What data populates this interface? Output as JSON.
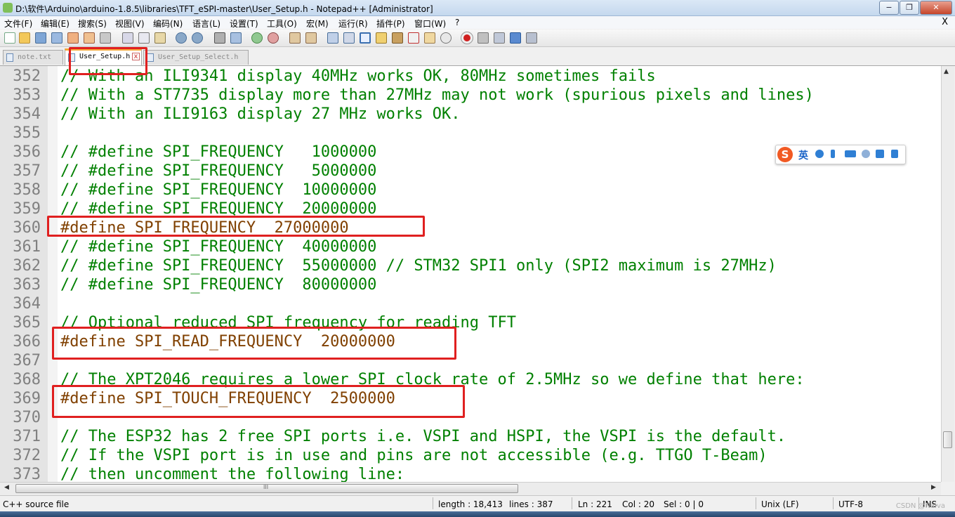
{
  "window": {
    "title": "D:\\软件\\Arduino\\arduino-1.8.5\\libraries\\TFT_eSPI-master\\User_Setup.h - Notepad++ [Administrator]",
    "min_label": "−",
    "max_label": "❐",
    "close_label": "✕"
  },
  "menu": {
    "items": [
      "文件(F)",
      "编辑(E)",
      "搜索(S)",
      "视图(V)",
      "编码(N)",
      "语言(L)",
      "设置(T)",
      "工具(O)",
      "宏(M)",
      "运行(R)",
      "插件(P)",
      "窗口(W)",
      "?"
    ],
    "close_label": "X"
  },
  "toolbar": {
    "icons": [
      "new-file-icon",
      "open-file-icon",
      "save-icon",
      "save-all-icon",
      "close-icon",
      "close-all-icon",
      "print-icon",
      "cut-icon",
      "copy-icon",
      "paste-icon",
      "undo-icon",
      "redo-icon",
      "find-icon",
      "replace-icon",
      "zoom-in-icon",
      "zoom-out-icon",
      "sync-vertical-icon",
      "sync-horizontal-icon",
      "word-wrap-icon",
      "show-all-chars-icon",
      "indent-guide-icon",
      "udl-icon",
      "doc-map-icon",
      "function-list-icon",
      "folder-workspace-icon",
      "monitoring-icon",
      "record-macro-icon",
      "stop-record-icon",
      "play-macro-icon",
      "run-macro-multiple-icon",
      "save-macro-icon"
    ]
  },
  "tabs": [
    {
      "label": "note.txt",
      "active": false
    },
    {
      "label": "User_Setup.h",
      "active": true
    },
    {
      "label": "User_Setup_Select.h",
      "active": false
    }
  ],
  "tab_close_label": "x",
  "editor": {
    "lines": [
      {
        "num": "352",
        "text": "// With an ILI9341 display 40MHz works OK, 80MHz sometimes fails",
        "type": "comment"
      },
      {
        "num": "353",
        "text": "// With a ST7735 display more than 27MHz may not work (spurious pixels and lines)",
        "type": "comment"
      },
      {
        "num": "354",
        "text": "// With an ILI9163 display 27 MHz works OK.",
        "type": "comment"
      },
      {
        "num": "355",
        "text": "",
        "type": "comment"
      },
      {
        "num": "356",
        "text": "// #define SPI_FREQUENCY   1000000",
        "type": "comment"
      },
      {
        "num": "357",
        "text": "// #define SPI_FREQUENCY   5000000",
        "type": "comment"
      },
      {
        "num": "358",
        "text": "// #define SPI_FREQUENCY  10000000",
        "type": "comment"
      },
      {
        "num": "359",
        "text": "// #define SPI_FREQUENCY  20000000",
        "type": "comment"
      },
      {
        "num": "360",
        "text": "#define SPI_FREQUENCY  27000000",
        "type": "directive"
      },
      {
        "num": "361",
        "text": "// #define SPI_FREQUENCY  40000000",
        "type": "comment"
      },
      {
        "num": "362",
        "text": "// #define SPI_FREQUENCY  55000000 // STM32 SPI1 only (SPI2 maximum is 27MHz)",
        "type": "comment"
      },
      {
        "num": "363",
        "text": "// #define SPI_FREQUENCY  80000000",
        "type": "comment"
      },
      {
        "num": "364",
        "text": "",
        "type": "comment"
      },
      {
        "num": "365",
        "text": "// Optional reduced SPI frequency for reading TFT",
        "type": "comment"
      },
      {
        "num": "366",
        "text": "#define SPI_READ_FREQUENCY  20000000",
        "type": "directive"
      },
      {
        "num": "367",
        "text": "",
        "type": "comment"
      },
      {
        "num": "368",
        "text": "// The XPT2046 requires a lower SPI clock rate of 2.5MHz so we define that here:",
        "type": "comment"
      },
      {
        "num": "369",
        "text": "#define SPI_TOUCH_FREQUENCY  2500000",
        "type": "directive"
      },
      {
        "num": "370",
        "text": "",
        "type": "comment"
      },
      {
        "num": "371",
        "text": "// The ESP32 has 2 free SPI ports i.e. VSPI and HSPI, the VSPI is the default.",
        "type": "comment"
      },
      {
        "num": "372",
        "text": "// If the VSPI port is in use and pins are not accessible (e.g. TTGO T-Beam)",
        "type": "comment"
      },
      {
        "num": "373",
        "text": "// then uncomment the following line:",
        "type": "comment"
      }
    ]
  },
  "ime": {
    "logo": "S",
    "lang": "英",
    "icons": [
      "moon-icon",
      "punctuation-icon",
      "keyboard-icon",
      "user-icon",
      "shirt-icon",
      "wrench-icon"
    ]
  },
  "scroll": {
    "up": "▲",
    "down": "▼",
    "left": "◀",
    "right": "▶",
    "grip": "III"
  },
  "status": {
    "filetype": "C++ source file",
    "length": "length : 18,413",
    "lines": "lines : 387",
    "ln": "Ln : 221",
    "col": "Col : 20",
    "sel": "Sel : 0 | 0",
    "eol": "Unix (LF)",
    "encoding": "UTF-8",
    "mode": "INS"
  },
  "watermark": "CSDN @Naiva",
  "colors": {
    "comment": "#008000",
    "directive": "#804000",
    "highlight_box": "#e02020"
  }
}
